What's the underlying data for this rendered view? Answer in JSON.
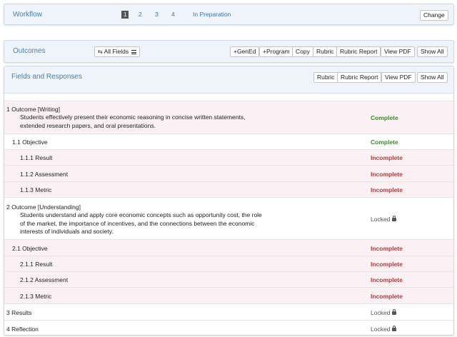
{
  "workflow": {
    "title": "Workflow",
    "steps": [
      "1",
      "2",
      "3",
      "4"
    ],
    "status": "In Preparation",
    "change_label": "Change"
  },
  "outcomes": {
    "title": "Outcomes",
    "fields_label": "All Fields",
    "buttons": [
      "+GenEd",
      "+Program",
      "Copy",
      "Rubric",
      "Rubric Report",
      "View PDF",
      "Show All"
    ]
  },
  "fields_responses": {
    "title": "Fields and Responses",
    "buttons": [
      "Rubric",
      "Rubric Report",
      "View PDF",
      "Show All"
    ],
    "rows": [
      {
        "label": "1 Outcome [Writing]",
        "desc": "Students effectively present their economic reasoning in concise written statements, extended research papers, and oral presentations.",
        "status": "Complete"
      },
      {
        "label": "1.1 Objective",
        "status": "Complete"
      },
      {
        "label": "1.1.1 Result",
        "status": "Incomplete"
      },
      {
        "label": "1.1.2 Assessment",
        "status": "Incomplete"
      },
      {
        "label": "1.1.3 Metric",
        "status": "Incomplete"
      },
      {
        "label": "2 Outcome [Understanding]",
        "desc": "Students understand and apply core economic concepts such as opportunity cost, the role of the market, the importance of incentives, and the connections between the economic interests of individuals and society.",
        "status": "Locked"
      },
      {
        "label": "2.1 Objective",
        "status": "Incomplete"
      },
      {
        "label": "2.1.1 Result",
        "status": "Incomplete"
      },
      {
        "label": "2.1.2 Assessment",
        "status": "Incomplete"
      },
      {
        "label": "2.1.3 Metric",
        "status": "Incomplete"
      },
      {
        "label": "3 Results",
        "status": "Locked"
      },
      {
        "label": "4 Reflection",
        "status": "Locked"
      }
    ]
  },
  "colors": {
    "complete": "#3c8b2b",
    "incomplete": "#b03a3a",
    "accent": "#4a7fb0"
  }
}
